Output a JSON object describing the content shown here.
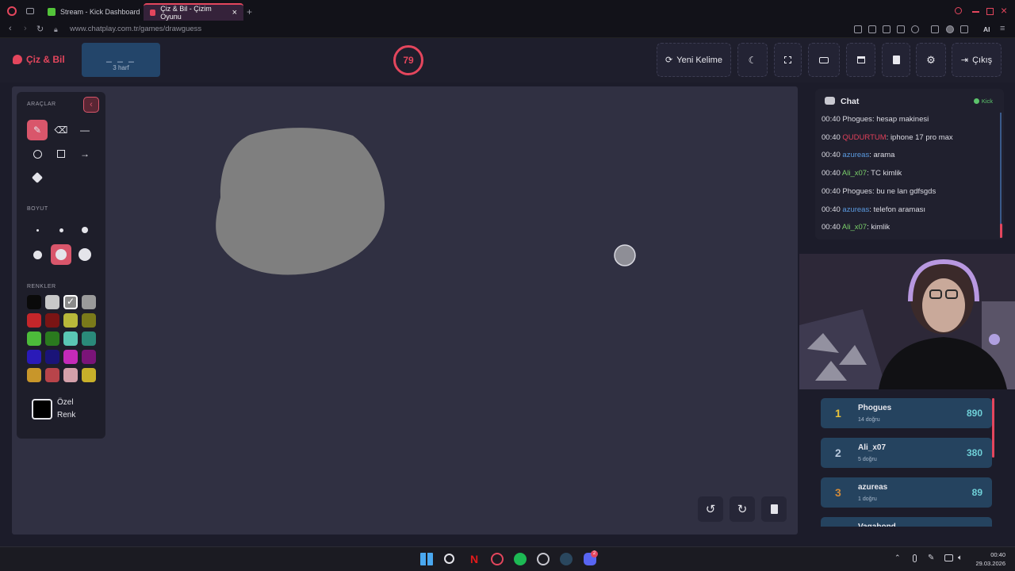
{
  "browser": {
    "tabs": [
      {
        "label": "Stream - Kick Dashboard"
      },
      {
        "label": "Çiz & Bil - Çizim Oyunu"
      }
    ],
    "url_host": "www.chatplay.com.tr",
    "url_path": "/games/drawguess",
    "ai_label": "AI"
  },
  "header": {
    "brand": "Çiz & Bil",
    "word_mask": "_ _ _",
    "word_hint": "3 harf",
    "timer": "79",
    "buttons": {
      "new_word": "Yeni Kelime",
      "exit": "Çıkış"
    }
  },
  "tools": {
    "section_tools": "ARAÇLAR",
    "section_size": "BOYUT",
    "section_colors": "RENKLER",
    "custom_color_line1": "Özel",
    "custom_color_line2": "Renk",
    "palette": [
      "#0a0a0a",
      "#c8c8c8",
      "#8a8a8a",
      "#9a9a9a",
      "#c4262a",
      "#7a1414",
      "#b8b83a",
      "#7a7a1a",
      "#4cbc3a",
      "#2a7a1e",
      "#5ac6b4",
      "#2a8a7a",
      "#2a1ab8",
      "#1a1478",
      "#c42ab8",
      "#7a1478",
      "#c8962a",
      "#b8444a",
      "#d4a0aa",
      "#c8b02a"
    ],
    "active_color": "#8a8a8a",
    "custom_color": "#000000"
  },
  "canvas": {
    "blob_color": "#7f7f7f"
  },
  "chat": {
    "title": "Chat",
    "platform": "Kick",
    "messages": [
      {
        "time": "00:40",
        "user": "Phogues",
        "color": "#dcdce4",
        "text": ": hesap makinesi"
      },
      {
        "time": "00:40",
        "user": "QUDURTUM",
        "color": "#e0405a",
        "text": ": iphone 17 pro max"
      },
      {
        "time": "00:40",
        "user": "azureas",
        "color": "#5a9ae0",
        "text": ": arama"
      },
      {
        "time": "00:40",
        "user": "Ali_x07",
        "color": "#7ad06a",
        "text": ": TC kimlik"
      },
      {
        "time": "00:40",
        "user": "Phogues",
        "color": "#dcdce4",
        "text": ": bu ne lan gdfsgds"
      },
      {
        "time": "00:40",
        "user": "azureas",
        "color": "#5a9ae0",
        "text": ": telefon araması"
      },
      {
        "time": "00:40",
        "user": "Ali_x07",
        "color": "#7ad06a",
        "text": ": kimlik"
      }
    ]
  },
  "leaderboard": [
    {
      "rank": "1",
      "name": "Phogues",
      "sub": "14 doğru",
      "score": "890",
      "rank_color": "#e8c23a"
    },
    {
      "rank": "2",
      "name": "Ali_x07",
      "sub": "5 doğru",
      "score": "380",
      "rank_color": "#b9c9dd"
    },
    {
      "rank": "3",
      "name": "azureas",
      "sub": "1 doğru",
      "score": "89",
      "rank_color": "#d08a3a"
    },
    {
      "rank": "",
      "name": "Vagabond",
      "sub": "",
      "score": "",
      "rank_color": "#b9c9dd"
    }
  ],
  "taskbar": {
    "time": "00:40",
    "date": "29.03.2026",
    "discord_badge": "2"
  }
}
